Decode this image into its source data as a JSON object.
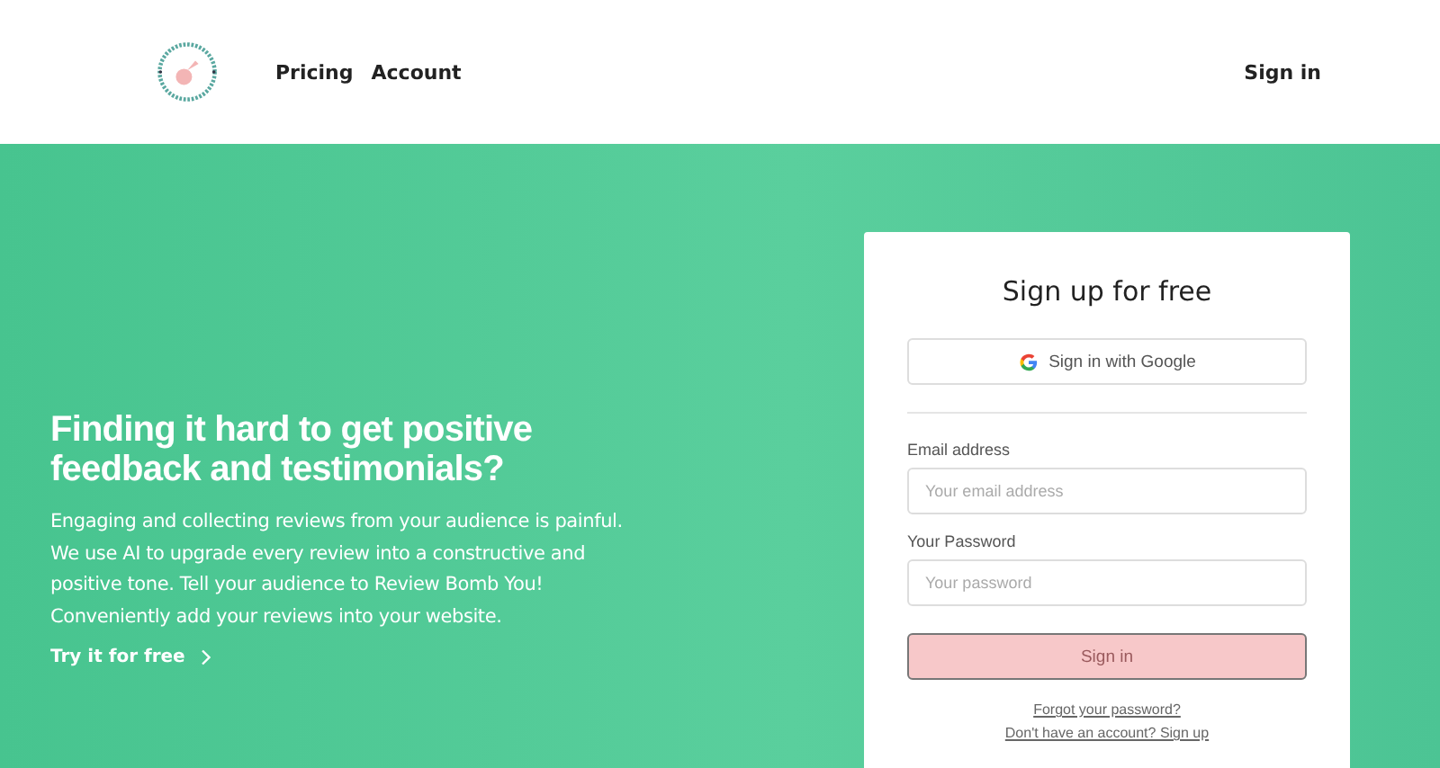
{
  "nav": {
    "links": [
      "Pricing",
      "Account"
    ],
    "sign_in": "Sign in"
  },
  "hero": {
    "headline": "Finding it hard to get positive feedback and testimonials?",
    "body": "Engaging and collecting reviews from your audience is painful. We use AI to upgrade every review into a constructive and positive tone. Tell your audience to Review Bomb You! Conveniently add your reviews into your website.",
    "cta": "Try it for free"
  },
  "signup": {
    "title": "Sign up for free",
    "google_button": "Sign in with Google",
    "fields": [
      {
        "label": "Email address",
        "placeholder": "Your email address"
      },
      {
        "label": "Your Password",
        "placeholder": "Your password"
      }
    ],
    "submit": {
      "label": "Sign in",
      "disabled": true
    },
    "forgot_link": "Forgot your password?",
    "signup_link": "Don't have an account? Sign up"
  }
}
